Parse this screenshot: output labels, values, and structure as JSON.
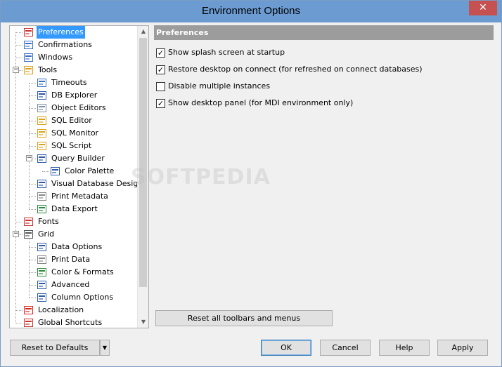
{
  "window": {
    "title": "Environment Options",
    "close_glyph": "✕"
  },
  "tree": {
    "items": [
      {
        "label": "Preferences",
        "icon": "check-doc-icon",
        "selected": true
      },
      {
        "label": "Confirmations",
        "icon": "dialog-icon"
      },
      {
        "label": "Windows",
        "icon": "windows-icon"
      },
      {
        "label": "Tools",
        "icon": "tools-icon",
        "expander": "−"
      },
      {
        "label": "Timeouts",
        "icon": "timeout-icon"
      },
      {
        "label": "DB Explorer",
        "icon": "db-explorer-icon"
      },
      {
        "label": "Object Editors",
        "icon": "object-editor-icon"
      },
      {
        "label": "SQL Editor",
        "icon": "sql-editor-icon"
      },
      {
        "label": "SQL Monitor",
        "icon": "sql-monitor-icon"
      },
      {
        "label": "SQL Script",
        "icon": "sql-script-icon"
      },
      {
        "label": "Query Builder",
        "icon": "query-builder-icon",
        "expander": "−"
      },
      {
        "label": "Color Palette",
        "icon": "color-palette-icon"
      },
      {
        "label": "Visual Database Designer",
        "icon": "designer-icon"
      },
      {
        "label": "Print Metadata",
        "icon": "printer-icon"
      },
      {
        "label": "Data Export",
        "icon": "data-export-icon"
      },
      {
        "label": "Fonts",
        "icon": "fonts-icon"
      },
      {
        "label": "Grid",
        "icon": "grid-icon",
        "expander": "−"
      },
      {
        "label": "Data Options",
        "icon": "data-options-icon"
      },
      {
        "label": "Print Data",
        "icon": "printer-icon"
      },
      {
        "label": "Color & Formats",
        "icon": "color-formats-icon"
      },
      {
        "label": "Advanced",
        "icon": "advanced-icon"
      },
      {
        "label": "Column Options",
        "icon": "column-options-icon"
      },
      {
        "label": "Localization",
        "icon": "flag-icon"
      },
      {
        "label": "Global Shortcuts",
        "icon": "shortcuts-icon"
      }
    ]
  },
  "panel": {
    "title": "Preferences",
    "options": [
      {
        "label": "Show splash screen at startup",
        "checked": true
      },
      {
        "label": "Restore desktop on connect (for refreshed on connect databases)",
        "checked": true
      },
      {
        "label": "Disable multiple instances",
        "checked": false
      },
      {
        "label": "Show desktop panel (for MDI environment only)",
        "checked": true
      }
    ],
    "reset_toolbars_label": "Reset all toolbars and menus"
  },
  "footer": {
    "reset_defaults_label": "Reset to Defaults",
    "dropdown_glyph": "▼",
    "ok_label": "OK",
    "cancel_label": "Cancel",
    "help_label": "Help",
    "apply_label": "Apply"
  },
  "watermark": "SOFTPEDIA",
  "colors": {
    "titlebar": "#6b9bd1",
    "selection": "#3399ff",
    "panel_header": "#9c9c9c",
    "close_button": "#c75050"
  }
}
